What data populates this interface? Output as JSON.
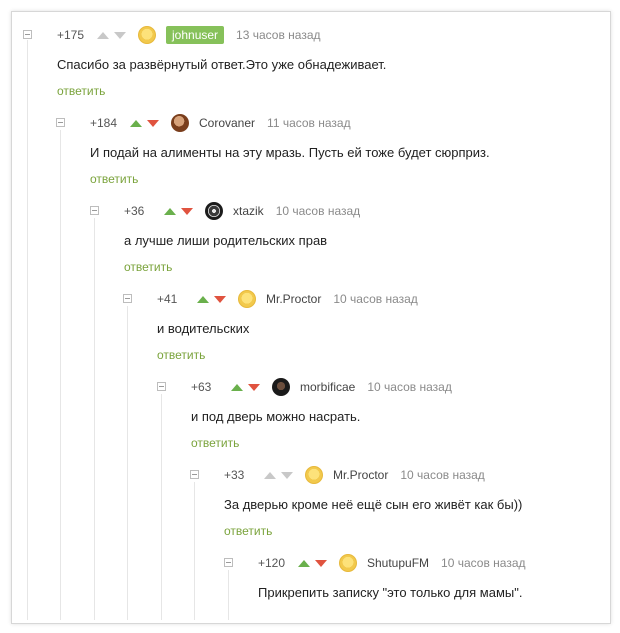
{
  "comments": [
    {
      "rating": "+175",
      "user": "johnuser",
      "time": "13 часов назад",
      "text": "Спасибо за развёрнутый ответ.Это уже обнадеживает.",
      "reply": "ответить",
      "avatar": "scared-face-avatar",
      "votes": "neutral",
      "op": true
    },
    {
      "rating": "+184",
      "user": "Corovaner",
      "time": "11 часов назад",
      "text": "И подай на алименты на эту мразь. Пусть ей тоже будет сюрприз.",
      "reply": "ответить",
      "avatar": "photo-avatar",
      "votes": "colored",
      "op": false
    },
    {
      "rating": "+36",
      "user": "xtazik",
      "time": "10 часов назад",
      "text": "а лучше лиши родительских прав",
      "reply": "ответить",
      "avatar": "emblem-avatar",
      "votes": "colored",
      "op": false
    },
    {
      "rating": "+41",
      "user": "Mr.Proctor",
      "time": "10 часов назад",
      "text": "и водительских",
      "reply": "ответить",
      "avatar": "scared-face-avatar",
      "votes": "colored",
      "op": false
    },
    {
      "rating": "+63",
      "user": "morbificae",
      "time": "10 часов назад",
      "text": "и под дверь можно насрать.",
      "reply": "ответить",
      "avatar": "photo-avatar",
      "votes": "colored",
      "op": false
    },
    {
      "rating": "+33",
      "user": "Mr.Proctor",
      "time": "10 часов назад",
      "text": "За дверью кроме неё ещё сын его живёт как бы))",
      "reply": "ответить",
      "avatar": "scared-face-avatar",
      "votes": "neutral",
      "op": false
    },
    {
      "rating": "+120",
      "user": "ShutupuFM",
      "time": "10 часов назад",
      "text": "Прикрепить записку \"это только для мамы\".",
      "avatar": "scared-face-avatar",
      "votes": "colored",
      "op": false
    }
  ],
  "colors": {
    "upvote": "#6ab04c",
    "downvote": "#e0533f",
    "reply_link": "#7aa33b",
    "op_badge": "#86c15a"
  }
}
